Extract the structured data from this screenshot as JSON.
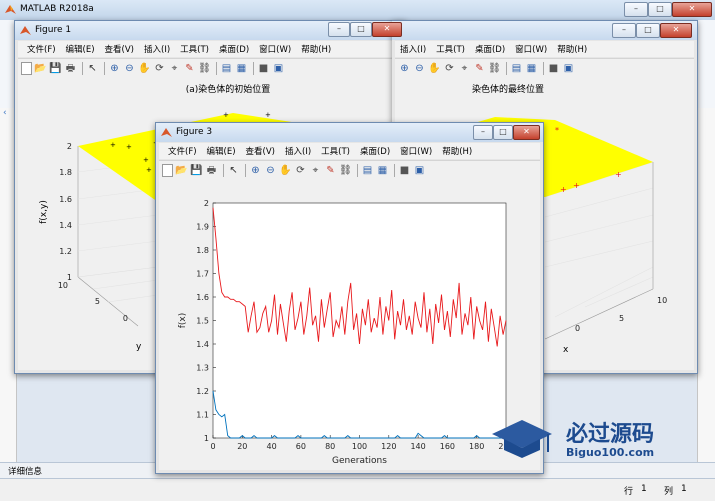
{
  "app": {
    "title": "MATLAB R2018a",
    "status_panel": "详细信息",
    "status_row_label": "行",
    "status_row_value": "1",
    "status_col_label": "列",
    "status_col_value": "1",
    "window_controls": [
      "minimize-icon",
      "maximize-icon",
      "close-icon"
    ]
  },
  "menus": [
    "文件(F)",
    "编辑(E)",
    "查看(V)",
    "插入(I)",
    "工具(T)",
    "桌面(D)",
    "窗口(W)",
    "帮助(H)"
  ],
  "toolbar_icons": [
    "new-file-icon",
    "open-folder-icon",
    "save-icon",
    "print-icon",
    "pointer-icon",
    "zoom-in-icon",
    "zoom-out-icon",
    "pan-icon",
    "rotate-icon",
    "data-cursor-icon",
    "brush-icon",
    "link-icon",
    "colorbar-icon",
    "legend-icon",
    "hide-plot-icon",
    "show-plot-icon"
  ],
  "figure1": {
    "title": "Figure 1",
    "plot_title": "(a)染色体的初始位置",
    "zlabel": "f(x,y)",
    "ylabel": "y",
    "z_ticks": [
      "2",
      "1.8",
      "1.6",
      "1.4",
      "1.2",
      "1"
    ],
    "y_ticks": [
      "10",
      "5",
      "0"
    ]
  },
  "figure2": {
    "plot_title": "染色体的最终位置",
    "xlabel": "x",
    "x_ticks": [
      "10",
      "5",
      "0"
    ]
  },
  "figure3": {
    "title": "Figure 3"
  },
  "colors": {
    "surface": "#ffff00",
    "best_series": "#0072bd",
    "mean_series": "#e8191c"
  },
  "chart_data": {
    "type": "line",
    "title": "",
    "xlabel": "Generations",
    "ylabel": "f(x)",
    "xlim": [
      0,
      200
    ],
    "ylim": [
      1,
      2
    ],
    "x_ticks": [
      0,
      20,
      40,
      60,
      80,
      100,
      120,
      140,
      160,
      180,
      200
    ],
    "y_ticks": [
      1,
      1.1,
      1.2,
      1.3,
      1.4,
      1.5,
      1.6,
      1.7,
      1.8,
      1.9,
      2
    ],
    "series": [
      {
        "values": [
          1.98,
          1.85,
          1.7,
          1.62,
          1.6,
          1.6,
          1.59,
          1.59,
          1.58,
          1.58,
          1.57,
          1.56,
          1.45,
          1.52,
          1.58,
          1.45,
          1.47,
          1.53,
          1.56,
          1.45,
          1.5,
          1.61,
          1.44,
          1.57,
          1.49,
          1.41,
          1.54,
          1.62,
          1.46,
          1.51,
          1.58,
          1.44,
          1.52,
          1.64,
          1.48,
          1.52,
          1.41,
          1.59,
          1.47,
          1.55,
          1.62,
          1.43,
          1.5,
          1.47,
          1.56,
          1.44,
          1.58,
          1.66,
          1.46,
          1.53,
          1.4,
          1.55,
          1.48,
          1.59,
          1.45,
          1.51,
          1.47,
          1.6,
          1.44,
          1.56,
          1.5,
          1.63,
          1.42,
          1.54,
          1.48,
          1.59,
          1.46,
          1.52,
          1.44,
          1.58,
          1.51,
          1.47,
          1.62,
          1.45,
          1.55,
          1.4,
          1.57,
          1.49,
          1.61,
          1.46,
          1.54,
          1.43,
          1.59,
          1.51,
          1.66,
          1.44,
          1.53,
          1.48,
          1.6,
          1.42,
          1.56,
          1.5,
          1.46,
          1.58,
          1.41,
          1.55,
          1.47,
          1.39,
          1.52,
          1.44,
          1.5
        ],
        "x_step": 2
      },
      {
        "values": [
          1.2,
          1.12,
          1.1,
          1.09,
          1.1,
          1.01,
          1.0,
          1.0,
          1.0,
          1.0,
          1.01,
          1.0,
          1.0,
          1.0,
          1.01,
          1.0,
          1.0,
          1.0,
          1.0,
          1.0,
          1.0,
          1.01,
          1.0,
          1.0,
          1.0,
          1.0,
          1.0,
          1.0,
          1.0,
          1.01,
          1.0,
          1.0,
          1.0,
          1.0,
          1.0,
          1.0,
          1.0,
          1.0,
          1.01,
          1.0,
          1.0,
          1.0,
          1.0,
          1.0,
          1.0,
          1.0,
          1.01,
          1.0,
          1.0,
          1.0,
          1.0,
          1.0,
          1.0,
          1.0,
          1.0,
          1.0,
          1.0,
          1.0,
          1.0,
          1.0,
          1.0,
          1.0,
          1.0,
          1.01,
          1.0,
          1.0,
          1.0,
          1.0,
          1.0,
          1.0,
          1.02,
          1.01,
          1.0,
          1.0,
          1.0,
          1.0,
          1.0,
          1.0,
          1.0,
          1.01,
          1.0,
          1.0,
          1.0,
          1.0,
          1.0,
          1.0,
          1.0,
          1.0,
          1.0,
          1.0,
          1.01,
          1.0,
          1.0,
          1.0,
          1.0,
          1.0,
          1.0,
          1.0,
          1.0,
          1.0,
          1.0
        ],
        "x_step": 2
      }
    ]
  }
}
